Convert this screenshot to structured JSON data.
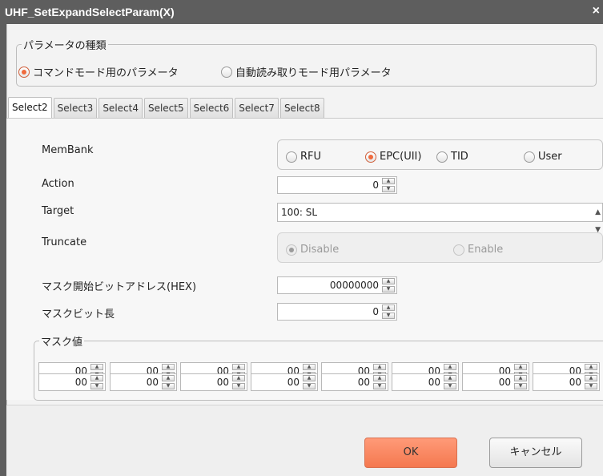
{
  "window": {
    "title": "UHF_SetExpandSelectParam(X)",
    "close_glyph": "×"
  },
  "param_type": {
    "legend": "パラメータの種類",
    "options": [
      {
        "label": "コマンドモード用のパラメータ",
        "selected": true
      },
      {
        "label": "自動読み取りモード用パラメータ",
        "selected": false
      }
    ]
  },
  "tabs": [
    "Select2",
    "Select3",
    "Select4",
    "Select5",
    "Select6",
    "Select7",
    "Select8"
  ],
  "active_tab": "Select2",
  "form": {
    "membank_label": "MemBank",
    "membank_options": [
      {
        "label": "RFU",
        "selected": false
      },
      {
        "label": "EPC(UII)",
        "selected": true
      },
      {
        "label": "TID",
        "selected": false
      },
      {
        "label": "User",
        "selected": false
      }
    ],
    "action_label": "Action",
    "action_value": "0",
    "target_label": "Target",
    "target_value": "100: SL",
    "truncate_label": "Truncate",
    "truncate_options": [
      {
        "label": "Disable",
        "selected": true
      },
      {
        "label": "Enable",
        "selected": false
      }
    ],
    "mask_addr_label": "マスク開始ビットアドレス(HEX)",
    "mask_addr_value": "00000000",
    "mask_len_label": "マスクビット長",
    "mask_len_value": "0"
  },
  "mask_value": {
    "legend": "マスク値",
    "row1": [
      "00",
      "00",
      "00",
      "00",
      "00",
      "00",
      "00",
      "00"
    ],
    "row2": [
      "00",
      "00",
      "00",
      "00",
      "00",
      "00",
      "00",
      "00"
    ]
  },
  "buttons": {
    "ok": "OK",
    "cancel": "キャンセル"
  },
  "colors": {
    "accent": "#f4784f",
    "titlebar": "#5e5e5e"
  }
}
